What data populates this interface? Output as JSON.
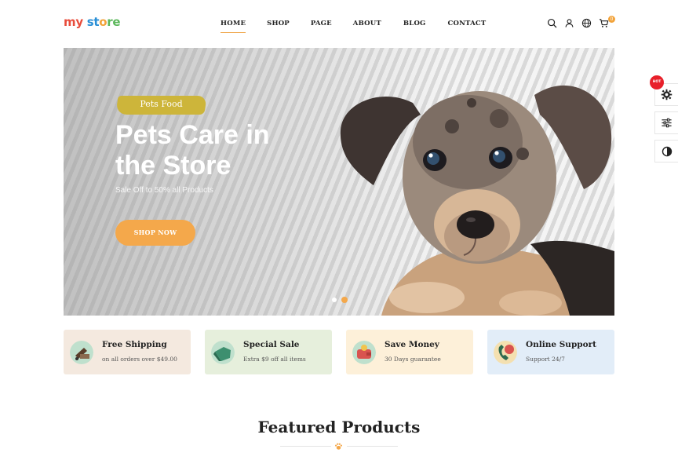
{
  "header": {
    "logo": {
      "part1": "my",
      "part2": " st",
      "part3": "o",
      "part4": "re"
    },
    "nav": [
      {
        "label": "HOME",
        "active": true
      },
      {
        "label": "SHOP",
        "active": false
      },
      {
        "label": "PAGE",
        "active": false
      },
      {
        "label": "ABOUT",
        "active": false
      },
      {
        "label": "BLOG",
        "active": false
      },
      {
        "label": "CONTACT",
        "active": false
      }
    ],
    "icons": [
      "search-icon",
      "user-icon",
      "globe-icon",
      "cart-icon"
    ],
    "cart_count": "0"
  },
  "hero": {
    "tag": "Pets Food",
    "title": "Pets Care in the Store",
    "subtitle": "Sale Off to 50% all Products",
    "button": "SHOP NOW",
    "slides": 2,
    "active_slide": 2
  },
  "side_tools": {
    "badge": "HOT",
    "icons": [
      "gear-icon",
      "sliders-icon",
      "contrast-icon"
    ]
  },
  "features": [
    {
      "title": "Free Shipping",
      "subtitle": "on all orders over $49.00",
      "bg": "#f4e9df",
      "icon": "delivery-icon"
    },
    {
      "title": "Special Sale",
      "subtitle": "Extra $9 off all items",
      "bg": "#e6efdc",
      "icon": "sale-tag-icon"
    },
    {
      "title": "Save Money",
      "subtitle": "30 Days guarantee",
      "bg": "#fdf0d9",
      "icon": "wallet-icon"
    },
    {
      "title": "Online Support",
      "subtitle": "Support 24/7",
      "bg": "#e2edf8",
      "icon": "support-24-icon"
    }
  ],
  "featured": {
    "title": "Featured Products",
    "icon": "paw-icon"
  },
  "colors": {
    "accent": "#f4a84b",
    "tag": "#cdb53a",
    "hot": "#e8202a"
  }
}
